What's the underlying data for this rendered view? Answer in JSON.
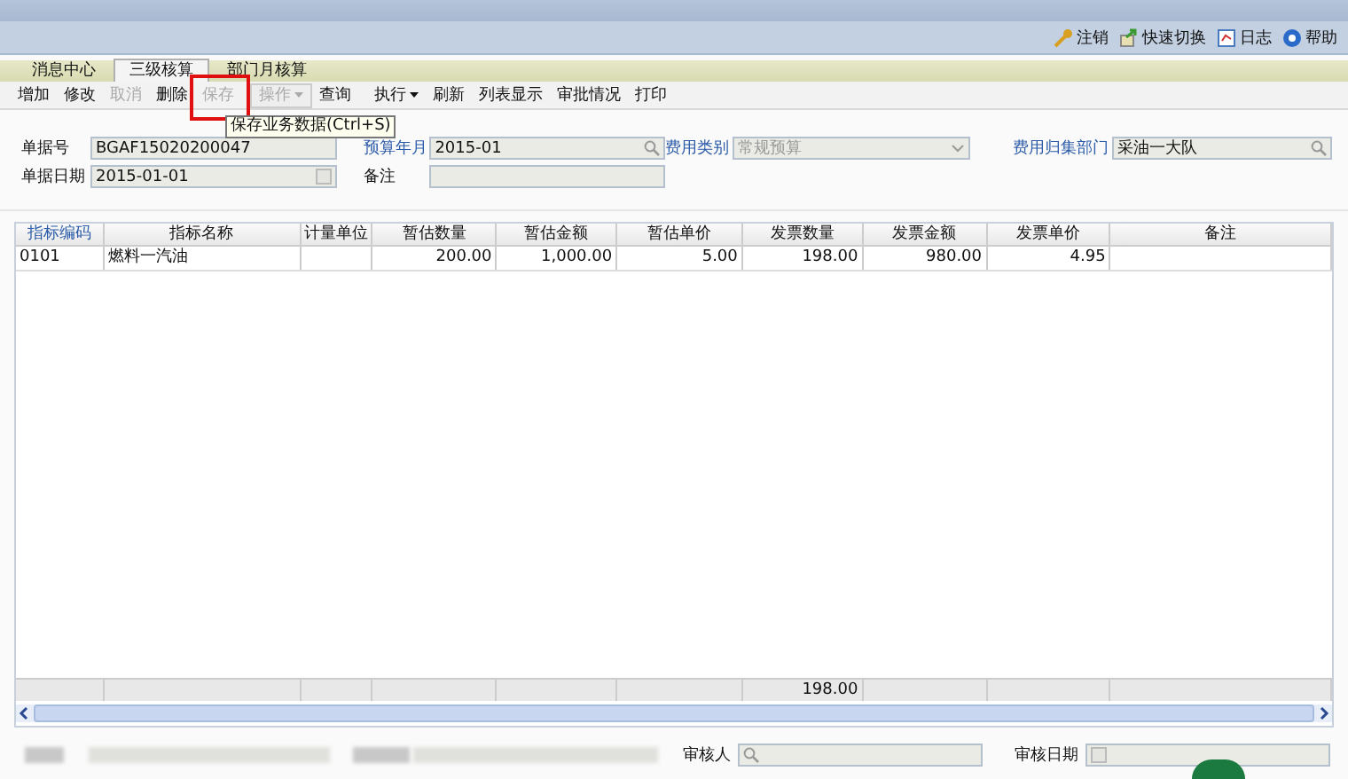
{
  "top_links": [
    {
      "kind": "key",
      "label": "注销"
    },
    {
      "kind": "switch",
      "label": "快速切换"
    },
    {
      "kind": "log",
      "label": "日志"
    },
    {
      "kind": "help",
      "label": "帮助"
    }
  ],
  "tabs": [
    {
      "label": "消息中心",
      "selected": false
    },
    {
      "label": "三级核算",
      "selected": true
    },
    {
      "label": "部门月核算",
      "selected": false
    }
  ],
  "toolbar": [
    {
      "label": "增加",
      "disabled": false,
      "kind": "button"
    },
    {
      "label": "修改",
      "disabled": false,
      "kind": "button"
    },
    {
      "label": "取消",
      "disabled": true,
      "kind": "button"
    },
    {
      "label": "删除",
      "disabled": false,
      "kind": "button"
    },
    {
      "label": "保存",
      "disabled": true,
      "kind": "button"
    },
    {
      "label": "操作",
      "disabled": true,
      "kind": "menu"
    },
    {
      "label": "查询",
      "disabled": false,
      "kind": "button"
    },
    {
      "label": "执行",
      "disabled": false,
      "kind": "menu"
    },
    {
      "label": "刷新",
      "disabled": false,
      "kind": "button"
    },
    {
      "label": "列表显示",
      "disabled": false,
      "kind": "button"
    },
    {
      "label": "审批情况",
      "disabled": false,
      "kind": "button"
    },
    {
      "label": "打印",
      "disabled": false,
      "kind": "button"
    }
  ],
  "tooltip": "保存业务数据(Ctrl+S)",
  "form": [
    [
      {
        "label": "单据号",
        "value": "BGAF15020200047",
        "kind": "text",
        "link": false
      },
      {
        "label": "预算年月",
        "value": "2015-01",
        "kind": "lookup",
        "link": true
      },
      {
        "label": "费用类别",
        "value": "常规预算",
        "kind": "select",
        "link": true,
        "disabled": true
      },
      {
        "label": "费用归集部门",
        "value": "采油一大队",
        "kind": "lookup",
        "link": true
      }
    ],
    [
      {
        "label": "单据日期",
        "value": "2015-01-01",
        "kind": "date",
        "link": false
      },
      {
        "label": "备注",
        "kind": "text",
        "link": false
      }
    ]
  ],
  "table": {
    "columns": [
      {
        "label": "指标编码",
        "link": true
      },
      {
        "label": "指标名称",
        "link": false
      },
      {
        "label": "计量单位",
        "link": false
      },
      {
        "label": "暂估数量",
        "link": false
      },
      {
        "label": "暂估金额",
        "link": false
      },
      {
        "label": "暂估单价",
        "link": false
      },
      {
        "label": "发票数量",
        "link": false
      },
      {
        "label": "发票金额",
        "link": false
      },
      {
        "label": "发票单价",
        "link": false
      },
      {
        "label": "备注",
        "link": false
      }
    ],
    "rows": [
      [
        "0101",
        "燃料一汽油",
        "",
        "200.00",
        "1,000.00",
        "5.00",
        "198.00",
        "980.00",
        "4.95",
        ""
      ]
    ],
    "invoice_quantity_total": "198.00"
  },
  "footer": [
    {
      "label": "审核人",
      "kind": "lookup"
    },
    {
      "label": "审核日期",
      "kind": "date"
    }
  ]
}
